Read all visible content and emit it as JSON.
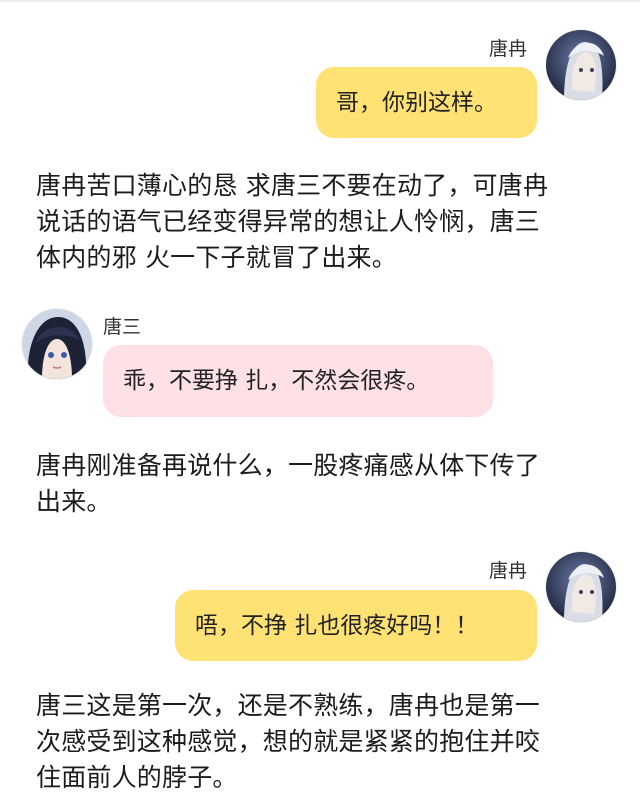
{
  "colors": {
    "bubble_right": "#ffe174",
    "bubble_left": "#fde1e7",
    "background": "#ffffff",
    "text": "#222222"
  },
  "messages": [
    {
      "side": "right",
      "name": "唐冉",
      "avatar": "avatar-tangran-icon",
      "text": "哥，你别这样。"
    },
    {
      "side": "left",
      "name": "唐三",
      "avatar": "avatar-tangsan-icon",
      "text": "乖，不要挣 扎，不然会很疼。"
    },
    {
      "side": "right",
      "name": "唐冉",
      "avatar": "avatar-tangran-icon",
      "text": "唔，不挣 扎也很疼好吗！！"
    }
  ],
  "narrations": [
    {
      "lines": [
        "唐冉苦口薄心的恳 求唐三不要在动了，可唐冉",
        "说话的语气已经变得异常的想让人怜悯，唐三",
        "体内的邪 火一下子就冒了出来。"
      ]
    },
    {
      "lines": [
        "唐冉刚准备再说什么，一股疼痛感从体下传了",
        "出来。"
      ]
    },
    {
      "lines": [
        "唐三这是第一次，还是不熟练，唐冉也是第一",
        "次感受到这种感觉，想的就是紧紧的抱住并咬",
        "住面前人的脖子。"
      ]
    }
  ]
}
